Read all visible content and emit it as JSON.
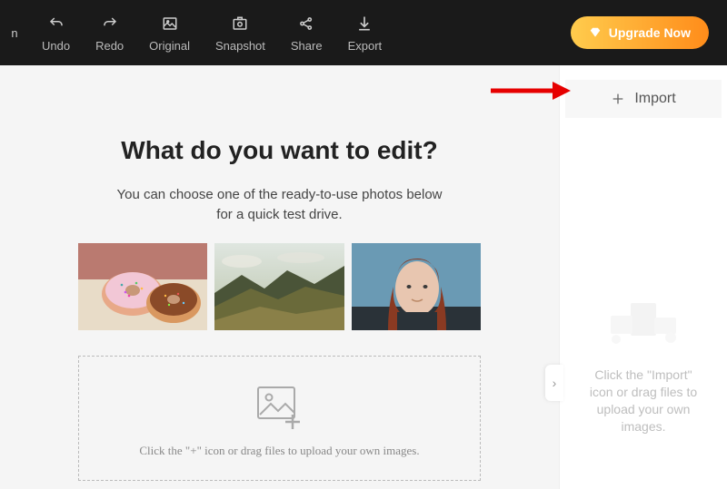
{
  "topbar": {
    "truncated_label": "n",
    "tools": {
      "undo": "Undo",
      "redo": "Redo",
      "original": "Original",
      "snapshot": "Snapshot",
      "share": "Share",
      "export": "Export"
    },
    "upgrade_label": "Upgrade Now"
  },
  "main": {
    "title": "What do you want to edit?",
    "subtitle_line1": "You can choose one of the ready-to-use photos below",
    "subtitle_line2": "for a quick test drive.",
    "dropzone_text": "Click the \"+\" icon or drag files to upload your own images."
  },
  "sidebar": {
    "import_label": "Import",
    "hint_line1": "Click the \"Import\"",
    "hint_line2": "icon or drag files to",
    "hint_line3": "upload your own",
    "hint_line4": "images."
  }
}
